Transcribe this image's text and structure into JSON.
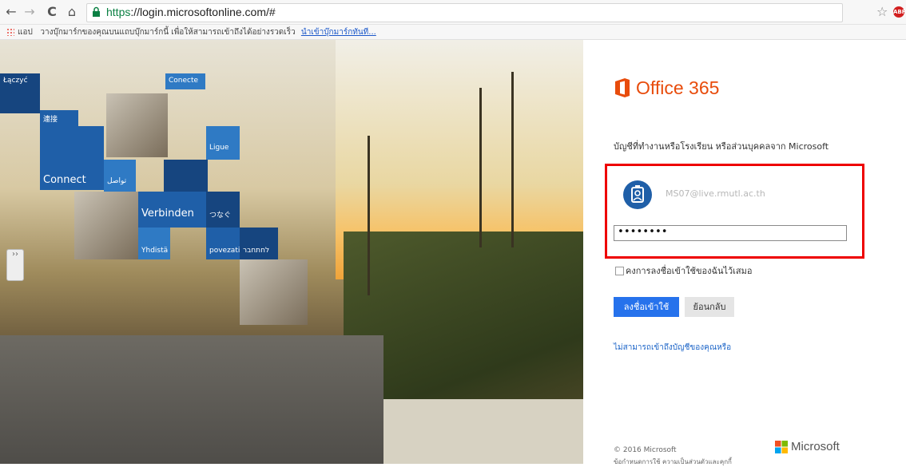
{
  "browser": {
    "back_icon": "←",
    "forward_icon": "→",
    "reload_icon": "C",
    "home_icon": "⌂",
    "url_https": "https",
    "url_rest": "://login.microsoftonline.com/#",
    "star_icon": "☆",
    "abp_label": "ABP",
    "menu_icon": "≡"
  },
  "bookmarks": {
    "apps_label": "แอป",
    "prompt_text": "วางบุ๊กมาร์กของคุณบนแถบบุ๊กมาร์กนี้ เพื่อให้สามารถเข้าถึงได้อย่างรวดเร็ว",
    "import_link": "นำเข้าบุ๊กมาร์กทันที..."
  },
  "hero": {
    "tiles": [
      "Łączyć",
      "Conecte",
      "連接",
      "Ligue",
      "Connect",
      "تواصل",
      "Verbinden",
      "つなぐ",
      "Yhdistä",
      "povezati",
      "לחתחבר"
    ],
    "handle_label": "››"
  },
  "login": {
    "product_name": "Office 365",
    "subtitle": "บัญชีที่ทำงานหรือโรงเรียน หรือส่วนบุคคลจาก Microsoft",
    "email": "MS07@live.rmutl.ac.th",
    "password_mask": "••••••••",
    "keep_signed_in": "คงการลงชื่อเข้าใช้ของฉันไว้เสมอ",
    "sign_in_button": "ลงชื่อเข้าใช้",
    "back_button": "ย้อนกลับ",
    "cant_access": "ไม่สามารถเข้าถึงบัญชีของคุณหรือ",
    "copyright": "© 2016 Microsoft",
    "footer_links": "ข้อกำหนดการใช้ ความเป็นส่วนตัวและคุกกี้",
    "ms_brand": "Microsoft",
    "accent_color": "#2672ec",
    "highlight_color": "#e00000"
  }
}
